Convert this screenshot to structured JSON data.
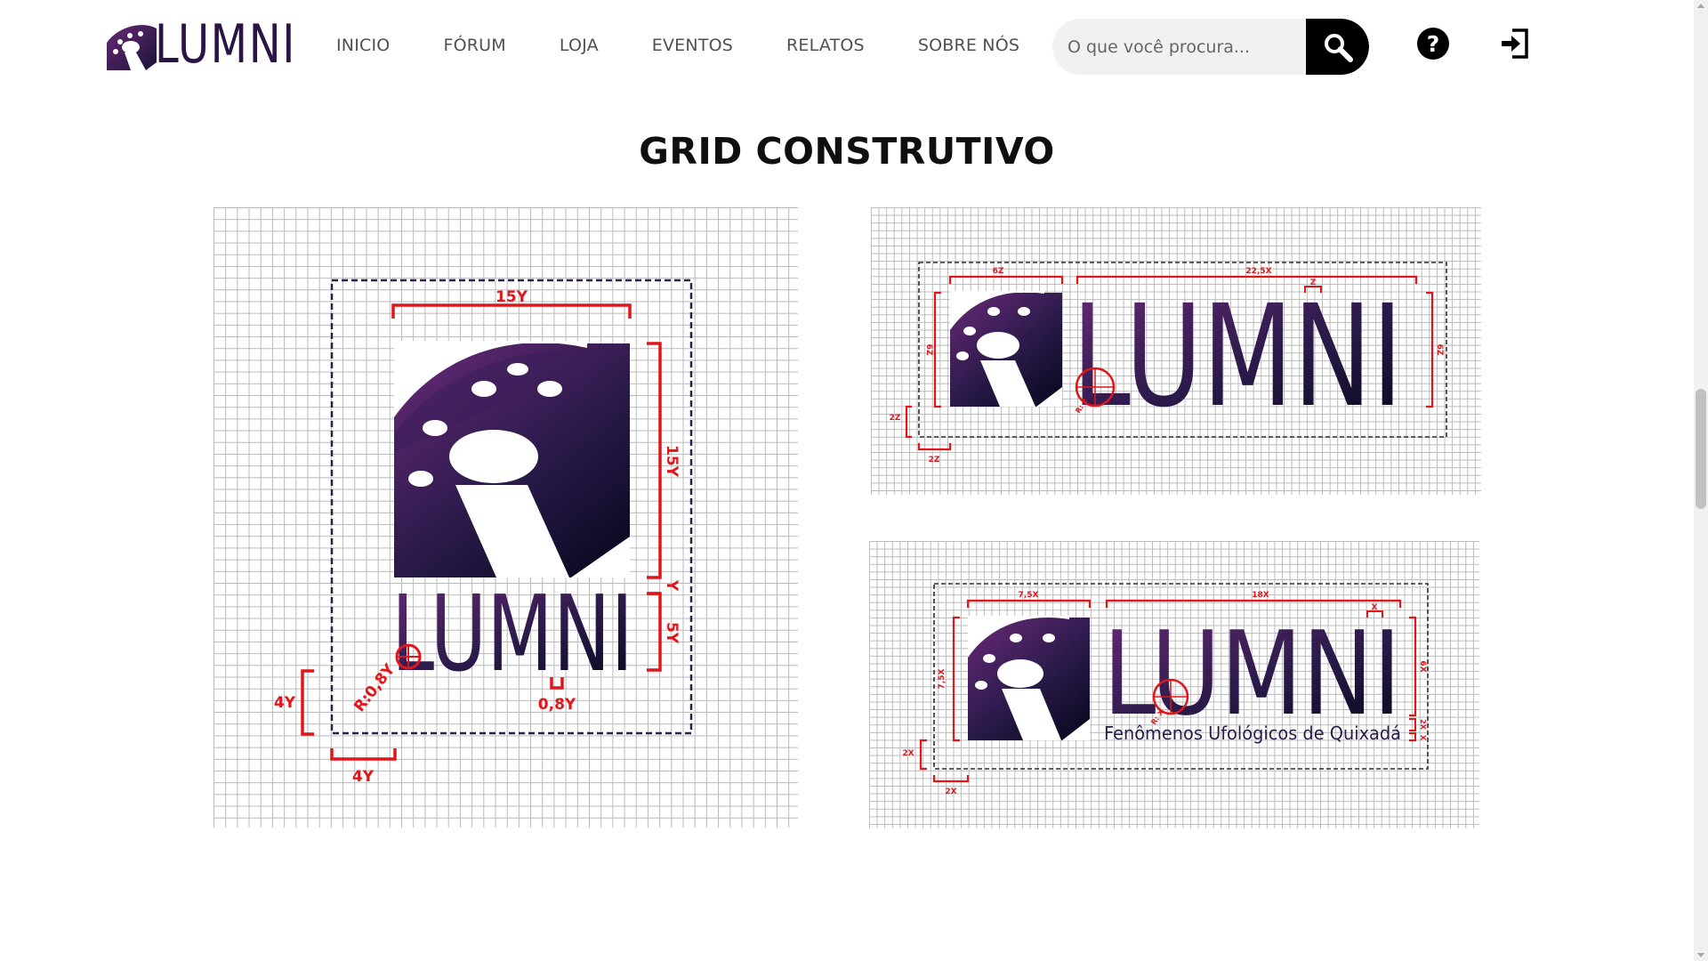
{
  "brand": {
    "name": "LUMNI",
    "color": "#2b1346"
  },
  "nav": {
    "items": [
      "INICIO",
      "FÓRUM",
      "LOJA",
      "EVENTOS",
      "RELATOS",
      "SOBRE NÓS"
    ]
  },
  "search": {
    "placeholder": "O que você procura...",
    "button_icon": "search-icon"
  },
  "header_icons": {
    "help": "question-circle-icon",
    "login": "sign-in-icon"
  },
  "section": {
    "title": "GRID CONSTRUTIVO"
  },
  "grid_vertical": {
    "wordmark": "LUMNI",
    "measures": {
      "width": "15Y",
      "height": "15Y",
      "gap": "Y",
      "text_height": "5Y",
      "radius": "R:0,8Y",
      "stroke": "0,8Y",
      "margin_left": "4Y",
      "margin_bottom": "4Y"
    }
  },
  "grid_horizontal": {
    "wordmark": "LUMNI",
    "measures": {
      "symbol_width": "6Z",
      "text_width": "22,5X",
      "stroke": "Z",
      "height_left": "6Z",
      "height_right": "6Z",
      "radius": "R: Z",
      "margin_left": "2Z",
      "margin_bottom": "2Z"
    }
  },
  "grid_horizontal_tagline": {
    "wordmark": "LUMNI",
    "tagline": "Fenômenos Ufológicos de Quixadá",
    "measures": {
      "symbol_width": "7,5X",
      "text_width": "18X",
      "stroke": "X",
      "height_left": "7,5X",
      "height_right": "6X",
      "tag_gap": "X",
      "tag_height": "2X",
      "radius": "R: X",
      "margin_left": "2X",
      "margin_bottom": "2X"
    }
  },
  "colors": {
    "accent_red": "#e0161b",
    "logo_top": "#6a2a78",
    "logo_bottom": "#1a1338",
    "search_bg": "#f1f1f1"
  }
}
